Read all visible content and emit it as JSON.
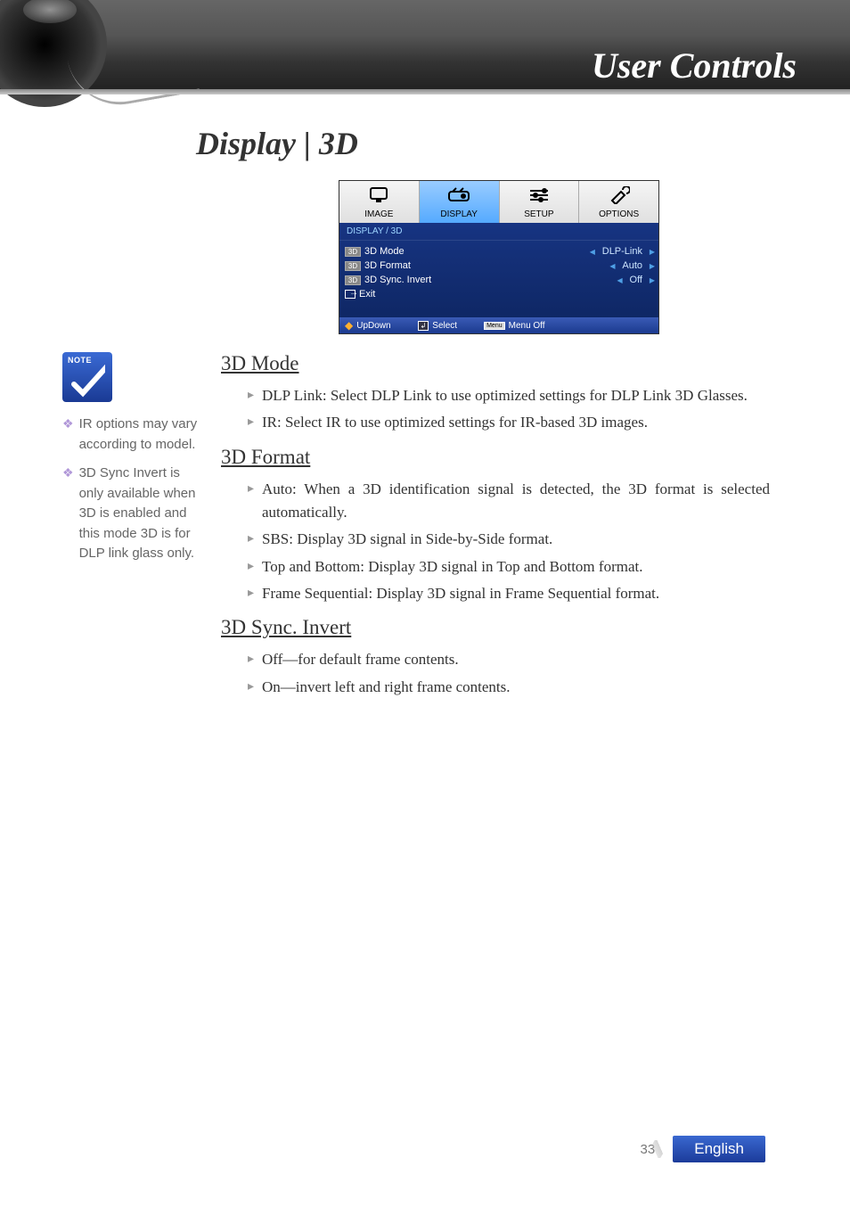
{
  "header": {
    "title": "User Controls"
  },
  "page_title": "Display | 3D",
  "osd": {
    "tabs": [
      {
        "label": "IMAGE"
      },
      {
        "label": "DISPLAY"
      },
      {
        "label": "SETUP"
      },
      {
        "label": "OPTIONS"
      }
    ],
    "active_tab": 1,
    "breadcrumb": "DISPLAY / 3D",
    "items": [
      {
        "badge": "3D",
        "label": "3D Mode",
        "value": "DLP-Link"
      },
      {
        "badge": "3D",
        "label": "3D Format",
        "value": "Auto"
      },
      {
        "badge": "3D",
        "label": "3D Sync. Invert",
        "value": "Off"
      }
    ],
    "exit_label": "Exit",
    "footer": {
      "updown": "UpDown",
      "select": "Select",
      "menuoff": "Menu Off",
      "menu_key": "Menu"
    }
  },
  "notes": [
    "IR options may vary according to model.",
    "3D Sync Invert is only available when 3D is enabled and this mode 3D is for DLP link glass only."
  ],
  "sections": {
    "s1": {
      "heading": "3D Mode",
      "bullets": [
        "DLP Link: Select DLP Link to use optimized settings for DLP Link 3D Glasses.",
        "IR: Select IR to use optimized settings for IR-based 3D images."
      ]
    },
    "s2": {
      "heading": "3D Format",
      "bullets": [
        "Auto: When a 3D identification signal is detected, the 3D format is selected automatically.",
        "SBS: Display 3D signal in Side-by-Side format.",
        "Top and Bottom: Display 3D signal in Top and Bottom format.",
        "Frame Sequential: Display 3D signal in Frame Sequential format."
      ]
    },
    "s3": {
      "heading": "3D Sync. Invert",
      "bullets": [
        "Off—for default frame contents.",
        "On—invert left and right frame contents."
      ]
    }
  },
  "footer": {
    "page": "33",
    "language": "English"
  }
}
